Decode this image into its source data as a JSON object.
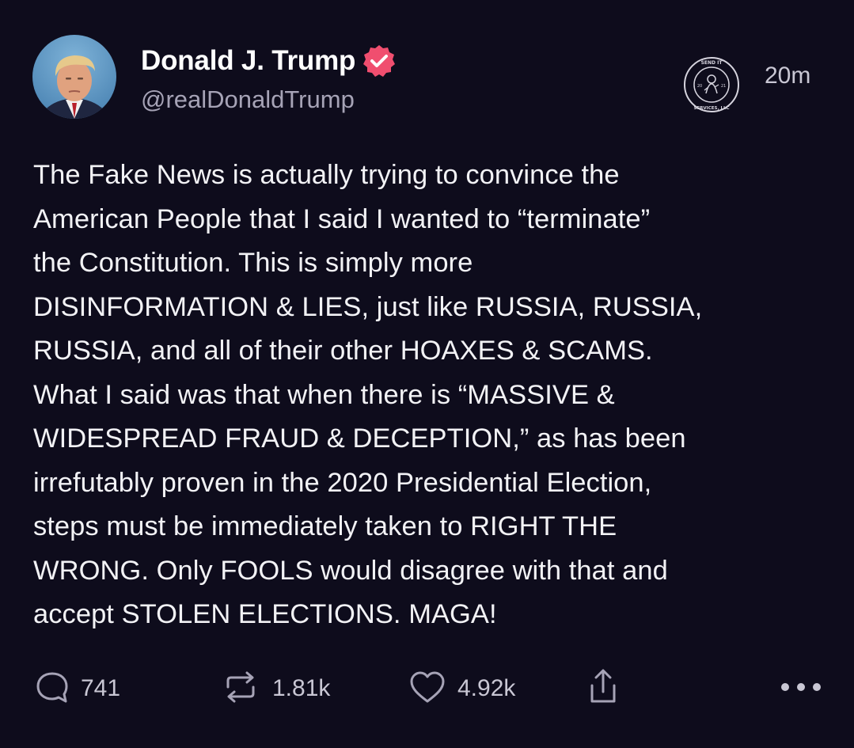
{
  "author": {
    "display_name": "Donald J. Trump",
    "handle": "@realDonaldTrump",
    "verified": true,
    "verified_color": "#f04e6f",
    "avatar": "profile-photo"
  },
  "badge": {
    "icon": "send-it-services-seal-icon",
    "lettering": [
      "SEND IT",
      "SERVICES, LLC",
      "20",
      "21"
    ]
  },
  "timestamp": "20m",
  "post": {
    "text": "The Fake News is actually trying to convince the\nAmerican People that I said I wanted to “terminate”\nthe Constitution. This is simply more\nDISINFORMATION & LIES, just like RUSSIA, RUSSIA,\nRUSSIA, and all of their other HOAXES & SCAMS.\nWhat I said was that when there is “MASSIVE &\nWIDESPREAD FRAUD & DECEPTION,” as has been\nirrefutably proven in the 2020 Presidential Election,\nsteps must be immediately taken to RIGHT THE\nWRONG. Only FOOLS would disagree with that and\naccept STOLEN ELECTIONS. MAGA!"
  },
  "actions": {
    "replies": "741",
    "retruths": "1.81k",
    "likes": "4.92k",
    "share_icon": "share-icon",
    "more_icon": "more-icon"
  },
  "colors": {
    "background": "#0e0c1c",
    "text": "#f2f2f5",
    "muted": "#a6a3b6"
  }
}
